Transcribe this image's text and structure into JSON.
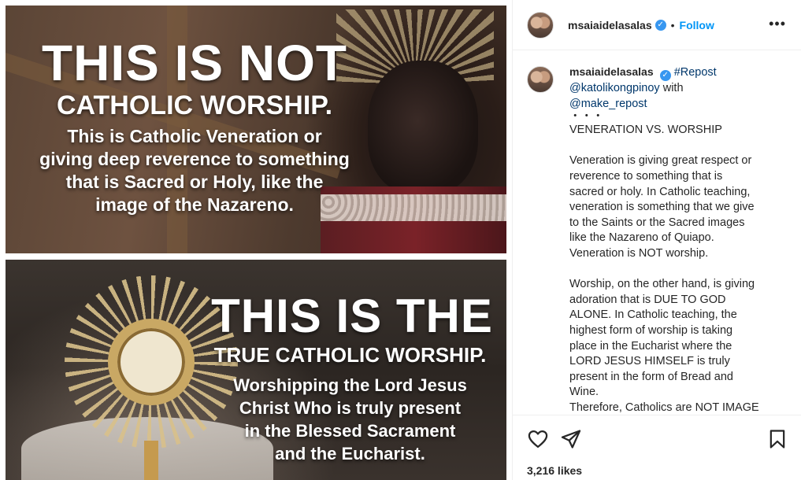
{
  "media": {
    "top_panel": {
      "headline": "THIS IS NOT",
      "subheadline": "CATHOLIC WORSHIP.",
      "body_lines": [
        "This is Catholic Veneration or",
        "giving deep reverence to something",
        "that is Sacred or Holy, like the",
        "image of the Nazareno."
      ]
    },
    "bottom_panel": {
      "headline": "THIS IS THE",
      "subheadline": "TRUE CATHOLIC WORSHIP.",
      "body_lines": [
        "Worshipping the Lord Jesus",
        "Christ Who is truly present",
        "in the Blessed Sacrament",
        "and the Eucharist."
      ]
    }
  },
  "header": {
    "username": "msaiaidelasalas",
    "verified_icon": "verified-badge-icon",
    "separator": "•",
    "follow_label": "Follow",
    "more_label": "•••"
  },
  "caption": {
    "username": "msaiaidelasalas",
    "repost_tag": "#Repost",
    "source_handle": "@katolikongpinoy",
    "with_word": "with",
    "tool_handle": "@make_repost",
    "ellipsis": "・・・",
    "title": "VENERATION VS. WORSHIP",
    "para1_lines": [
      "Veneration is giving great respect or",
      "reverence to something that is",
      "sacred or holy. In Catholic teaching,",
      "veneration is something that we give",
      "to the Saints or the Sacred images",
      "like the Nazareno of Quiapo.",
      "Veneration is NOT worship."
    ],
    "para2_lines": [
      "Worship, on the other hand, is giving",
      "adoration that is DUE TO GOD",
      "ALONE. In Catholic teaching, the",
      "highest form of worship is taking",
      "place in the Eucharist where the",
      "LORD JESUS HIMSELF is truly",
      "present in the form of Bread and",
      "Wine.",
      "Therefore, Catholics are NOT IMAGE"
    ]
  },
  "actions": {
    "like_icon": "heart-icon",
    "share_icon": "paper-plane-icon",
    "save_icon": "bookmark-icon",
    "likes_text": "3,216 likes"
  },
  "colors": {
    "follow_blue": "#0095f6",
    "verified_blue": "#3897f0",
    "link_dark_blue": "#00376b",
    "text": "#262626",
    "divider": "#efefef"
  }
}
